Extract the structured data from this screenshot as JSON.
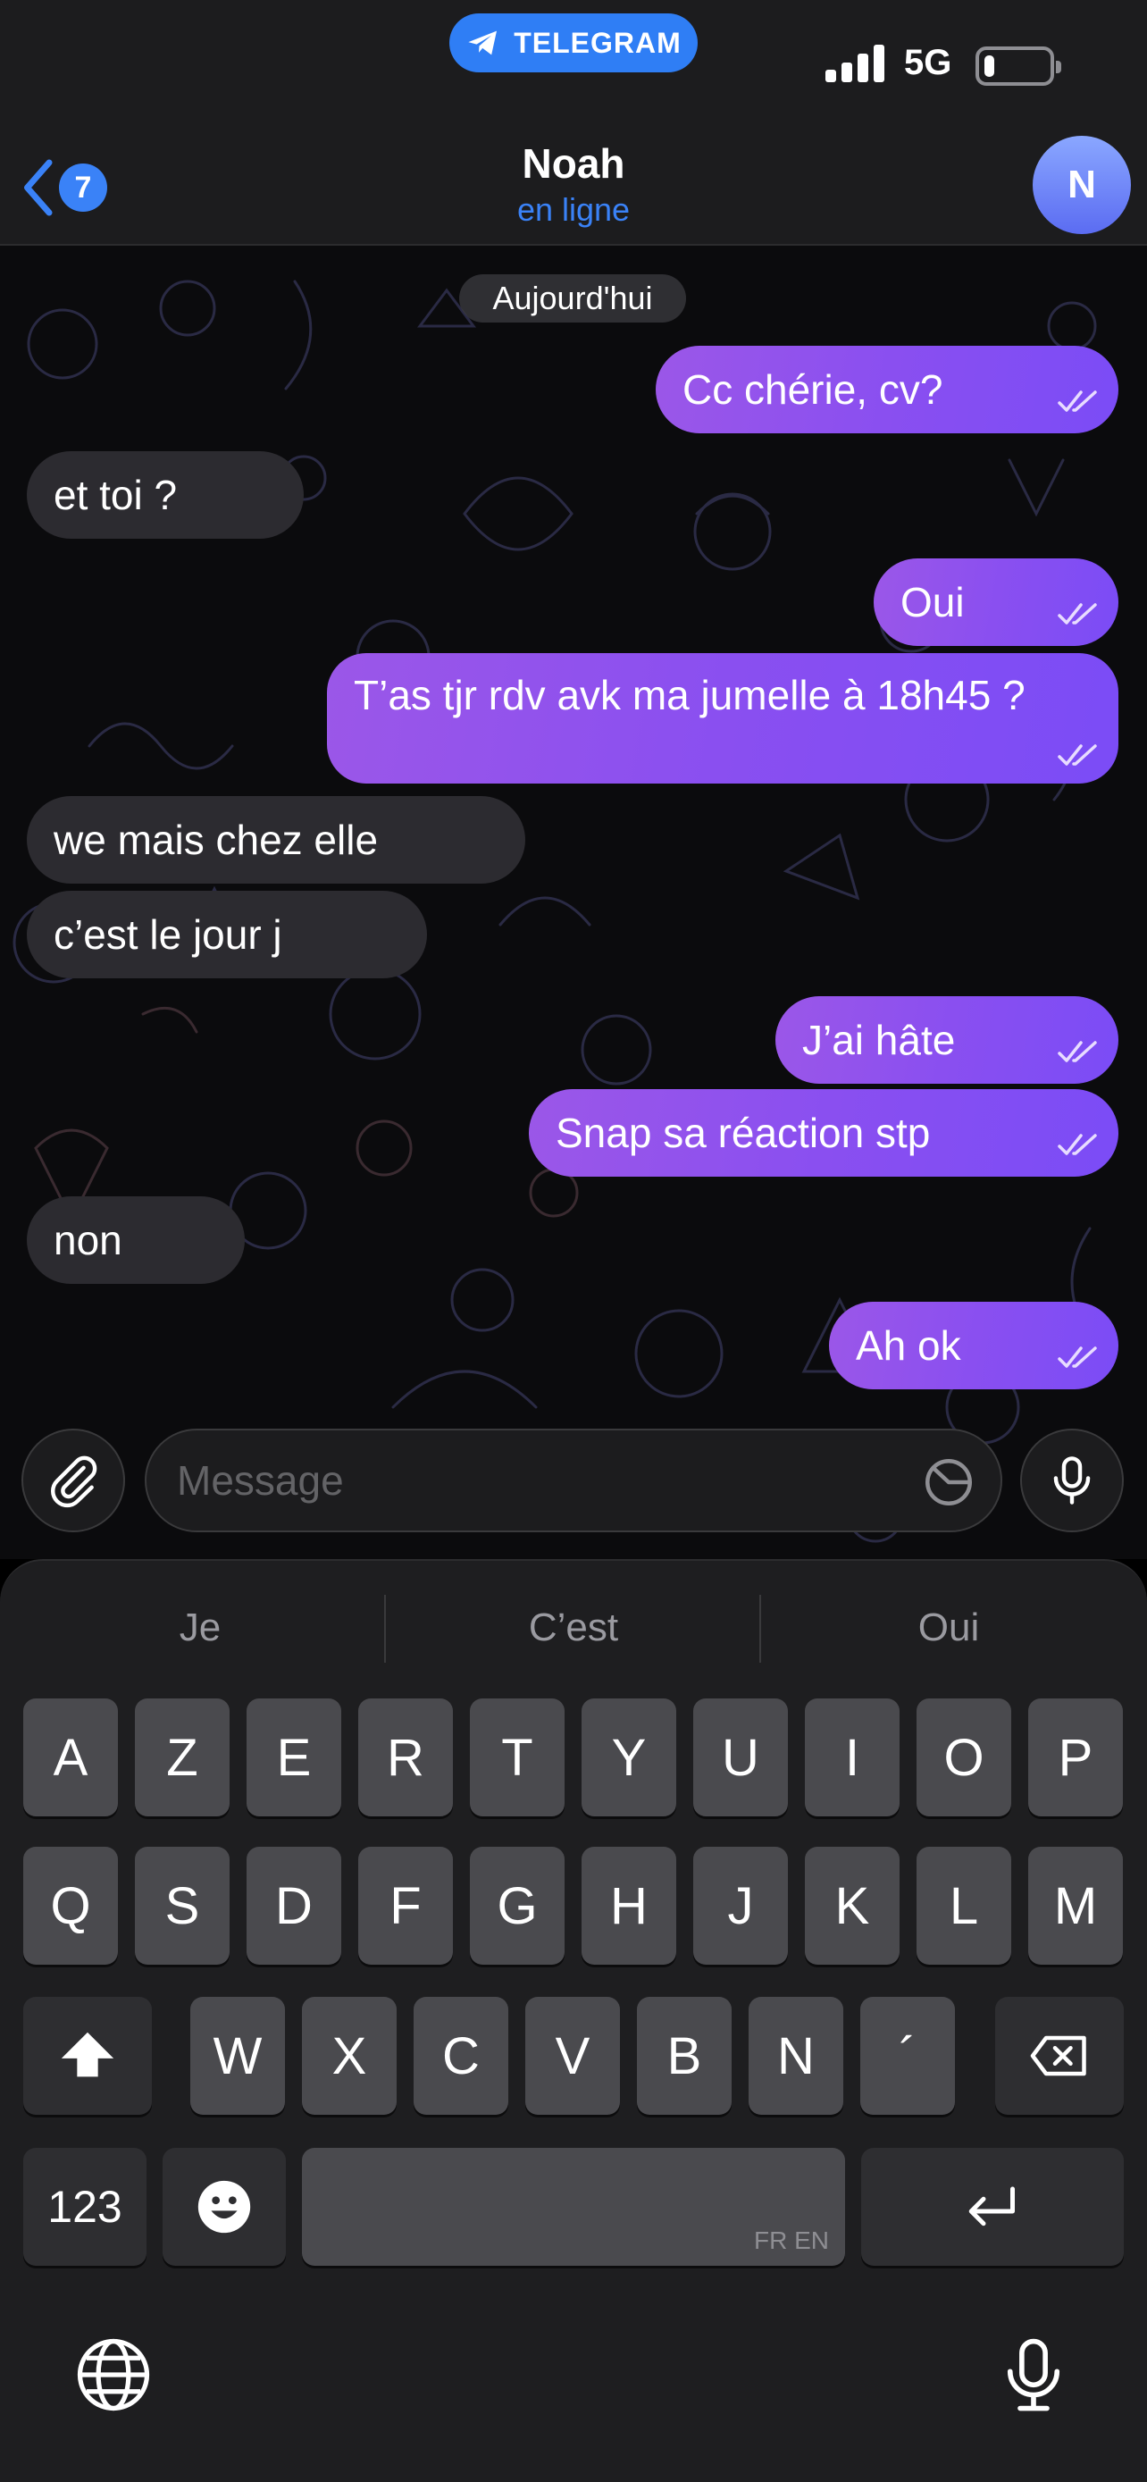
{
  "status_bar": {
    "app_pill": "TELEGRAM",
    "network": "5G",
    "battery_level": 0.15
  },
  "header": {
    "back_count": "7",
    "contact_name": "Noah",
    "contact_status": "en ligne",
    "avatar_initial": "N"
  },
  "chat": {
    "date_label": "Aujourd'hui",
    "messages": [
      {
        "direction": "out",
        "text": "Cc chérie, cv?",
        "read": true
      },
      {
        "direction": "in",
        "text": "et toi ?"
      },
      {
        "direction": "out",
        "text": "Oui",
        "read": true
      },
      {
        "direction": "out",
        "text": "T’as tjr rdv avk ma jumelle à 18h45 ?",
        "read": true
      },
      {
        "direction": "in",
        "text": "we mais chez elle"
      },
      {
        "direction": "in",
        "text": "c’est le jour j"
      },
      {
        "direction": "out",
        "text": "J’ai hâte",
        "read": true
      },
      {
        "direction": "out",
        "text": "Snap sa réaction stp",
        "read": true
      },
      {
        "direction": "in",
        "text": "non"
      },
      {
        "direction": "out",
        "text": "Ah ok",
        "read": true
      }
    ]
  },
  "input": {
    "placeholder": "Message",
    "value": ""
  },
  "keyboard": {
    "suggestions": [
      "Je",
      "C’est",
      "Oui"
    ],
    "row1": [
      "A",
      "Z",
      "E",
      "R",
      "T",
      "Y",
      "U",
      "I",
      "O",
      "P"
    ],
    "row2": [
      "Q",
      "S",
      "D",
      "F",
      "G",
      "H",
      "J",
      "K",
      "L",
      "M"
    ],
    "row3": [
      "W",
      "X",
      "C",
      "V",
      "B",
      "N",
      "´"
    ],
    "numbers_key": "123",
    "space_lang": "FR EN"
  },
  "colors": {
    "accent": "#3a82f7",
    "outgoing_bubble": "#8a4ff0",
    "incoming_bubble": "#2c2b30"
  }
}
